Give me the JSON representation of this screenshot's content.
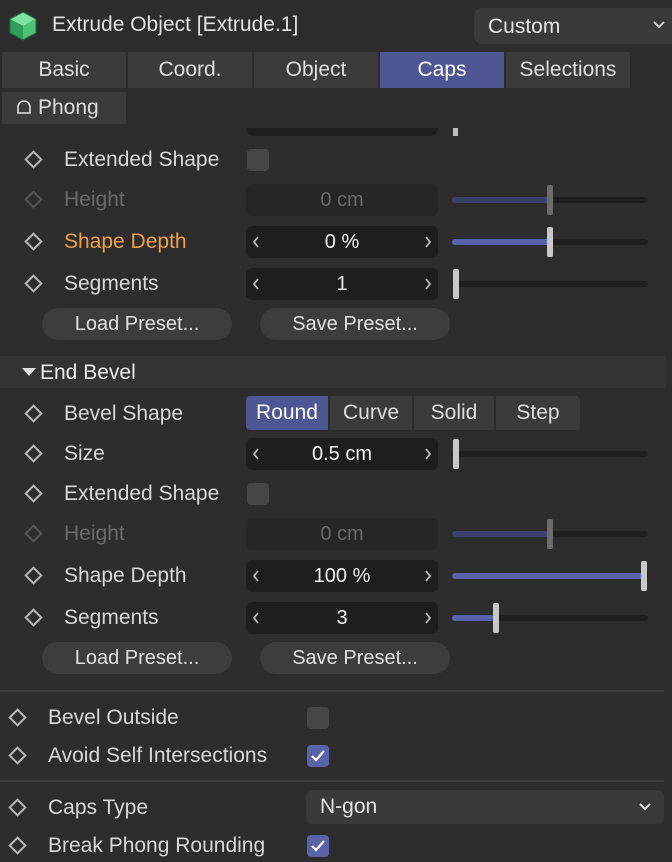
{
  "header": {
    "title": "Extrude Object [Extrude.1]",
    "layout_dropdown": "Custom",
    "icon": "cube-icon"
  },
  "tabs": [
    {
      "label": "Basic",
      "active": false
    },
    {
      "label": "Coord.",
      "active": false
    },
    {
      "label": "Object",
      "active": false
    },
    {
      "label": "Caps",
      "active": true
    },
    {
      "label": "Selections",
      "active": false
    }
  ],
  "phong_tab": {
    "label": "Phong",
    "icon": "phong-bell-icon"
  },
  "start_bevel": {
    "extended_shape": {
      "label": "Extended Shape",
      "checked": false
    },
    "height": {
      "label": "Height",
      "value": "0 cm",
      "enabled": false,
      "slider": 0.5
    },
    "shape_depth": {
      "label": "Shape Depth",
      "value": "0 %",
      "highlight": true,
      "slider": 0.5
    },
    "segments": {
      "label": "Segments",
      "value": "1",
      "slider": 0.0
    },
    "load_preset": "Load Preset...",
    "save_preset": "Save Preset..."
  },
  "end_bevel": {
    "title": "End Bevel",
    "bevel_shape": {
      "label": "Bevel Shape",
      "options": [
        "Round",
        "Curve",
        "Solid",
        "Step"
      ],
      "selected": "Round"
    },
    "size": {
      "label": "Size",
      "value": "0.5 cm",
      "slider": 0.0
    },
    "extended_shape": {
      "label": "Extended Shape",
      "checked": false
    },
    "height": {
      "label": "Height",
      "value": "0 cm",
      "enabled": false,
      "slider": 0.5
    },
    "shape_depth": {
      "label": "Shape Depth",
      "value": "100 %",
      "slider": 1.0
    },
    "segments": {
      "label": "Segments",
      "value": "3",
      "slider": 0.2
    },
    "load_preset": "Load Preset...",
    "save_preset": "Save Preset..."
  },
  "bevel_outside": {
    "label": "Bevel Outside",
    "checked": false
  },
  "avoid_self_intersections": {
    "label": "Avoid Self Intersections",
    "checked": true
  },
  "caps_type": {
    "label": "Caps Type",
    "value": "N-gon"
  },
  "break_phong_rounding": {
    "label": "Break Phong Rounding",
    "checked": true
  },
  "colors": {
    "accent": "#4f5694",
    "slider_fill": "#5a62a8",
    "highlight_label": "#f0a040",
    "background": "#2d2d2d"
  }
}
